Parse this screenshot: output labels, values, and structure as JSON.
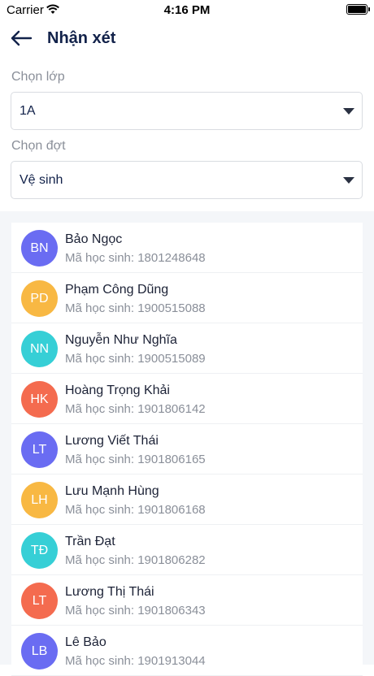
{
  "status": {
    "carrier": "Carrier",
    "time": "4:16 PM"
  },
  "header": {
    "title": "Nhận xét"
  },
  "class_select": {
    "label": "Chọn lớp",
    "value": "1A"
  },
  "period_select": {
    "label": "Chọn đợt",
    "value": "Vệ sinh"
  },
  "students": [
    {
      "initials": "BN",
      "name": "Bảo Ngọc",
      "code": "Mã học sinh: 1801248648",
      "color": "#6a6cf2"
    },
    {
      "initials": "PD",
      "name": "Phạm Công Dũng",
      "code": "Mã học sinh: 1900515088",
      "color": "#f8b843"
    },
    {
      "initials": "NN",
      "name": "Nguyễn Như Nghĩa",
      "code": "Mã học sinh: 1900515089",
      "color": "#36cfd6"
    },
    {
      "initials": "HK",
      "name": "Hoàng Trọng Khải",
      "code": "Mã học sinh: 1901806142",
      "color": "#f46b4f"
    },
    {
      "initials": "LT",
      "name": "Lương Viết Thái",
      "code": "Mã học sinh: 1901806165",
      "color": "#6a6cf2"
    },
    {
      "initials": "LH",
      "name": "Lưu Mạnh Hùng",
      "code": "Mã học sinh: 1901806168",
      "color": "#f8b843"
    },
    {
      "initials": "TĐ",
      "name": "Trần Đạt",
      "code": "Mã học sinh: 1901806282",
      "color": "#36cfd6"
    },
    {
      "initials": "LT",
      "name": "Lương Thị Thái",
      "code": "Mã học sinh: 1901806343",
      "color": "#f46b4f"
    },
    {
      "initials": "LB",
      "name": "Lê Bảo",
      "code": "Mã học sinh: 1901913044",
      "color": "#6a6cf2"
    }
  ]
}
